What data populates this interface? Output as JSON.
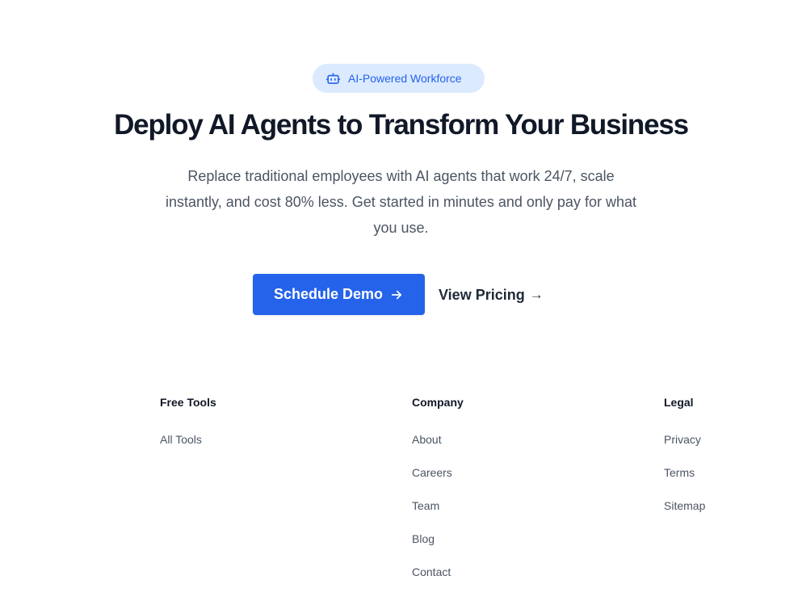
{
  "hero": {
    "badge": {
      "icon": "robot-icon",
      "label": "AI-Powered Workforce",
      "bg_color": "#dbeafe",
      "text_color": "#2563eb"
    },
    "headline": "Deploy AI Agents to Transform Your Business",
    "subtext": "Replace traditional employees with AI agents that work 24/7, scale instantly, and cost 80% less. Get started in minutes and only pay for what you use.",
    "primary_button": {
      "label": "Schedule Demo",
      "icon": "arrow-right-icon",
      "color": "#2563eb"
    },
    "secondary_button": {
      "label": "View Pricing",
      "arrow": "→"
    }
  },
  "footer": {
    "columns": [
      {
        "title": "Free Tools",
        "links": [
          "All Tools"
        ]
      },
      {
        "title": "Company",
        "links": [
          "About",
          "Careers",
          "Team",
          "Blog",
          "Contact"
        ]
      },
      {
        "title": "Legal",
        "links": [
          "Privacy",
          "Terms",
          "Sitemap"
        ]
      }
    ]
  }
}
